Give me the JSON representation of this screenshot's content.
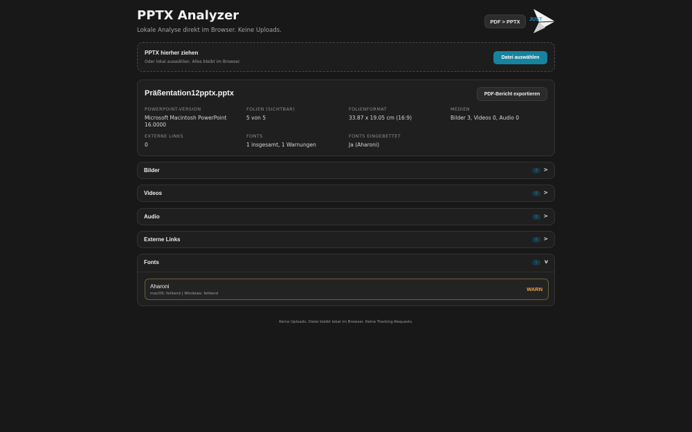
{
  "header": {
    "title": "PPTX Analyzer",
    "subtitle": "Lokale Analyse direkt im Browser. Keine Uploads.",
    "pdf_pptx_label": "PDF > PPTX",
    "logo_text": "JUST"
  },
  "dropzone": {
    "title": "PPTX hierher ziehen",
    "hint": "Oder lokal auswählen. Alles bleibt im Browser.",
    "button_label": "Datei auswählen"
  },
  "summary": {
    "file_name": "Präßentation12pptx.pptx",
    "export_label": "PDF-Bericht exportieren",
    "meta": [
      {
        "label": "PowerPoint-Version",
        "value": "Microsoft Macintosh PowerPoint 16.0000"
      },
      {
        "label": "Folien (sichtbar)",
        "value": "5 von 5"
      },
      {
        "label": "Folienformat",
        "value": "33.87 x 19.05 cm (16:9)"
      },
      {
        "label": "Medien",
        "value": "Bilder 3, Videos 0, Audio 0"
      },
      {
        "label": "Externe Links",
        "value": "0"
      },
      {
        "label": "Fonts",
        "value": "1 insgesamt, 1 Warnungen"
      },
      {
        "label": "Fonts eingebettet",
        "value": "Ja (Aharoni)"
      }
    ]
  },
  "sections": [
    {
      "title": "Bilder",
      "count": "3",
      "chevron": ">"
    },
    {
      "title": "Videos",
      "count": "0",
      "chevron": ">"
    },
    {
      "title": "Audio",
      "count": "0",
      "chevron": ">"
    },
    {
      "title": "Externe Links",
      "count": "0",
      "chevron": ">"
    }
  ],
  "fonts_section": {
    "title": "Fonts",
    "count": "1",
    "chevron": "v",
    "items": [
      {
        "name": "Aharoni",
        "status": "macOS: fehlend | Windows: fehlend",
        "badge": "WARN"
      }
    ]
  },
  "footer": {
    "text": "Keine Uploads. Datei bleibt lokal im Browser. Keine Tracking-Requests."
  },
  "colors": {
    "accent": "#16839f",
    "warn": "#f0a43a",
    "background": "#181818"
  }
}
